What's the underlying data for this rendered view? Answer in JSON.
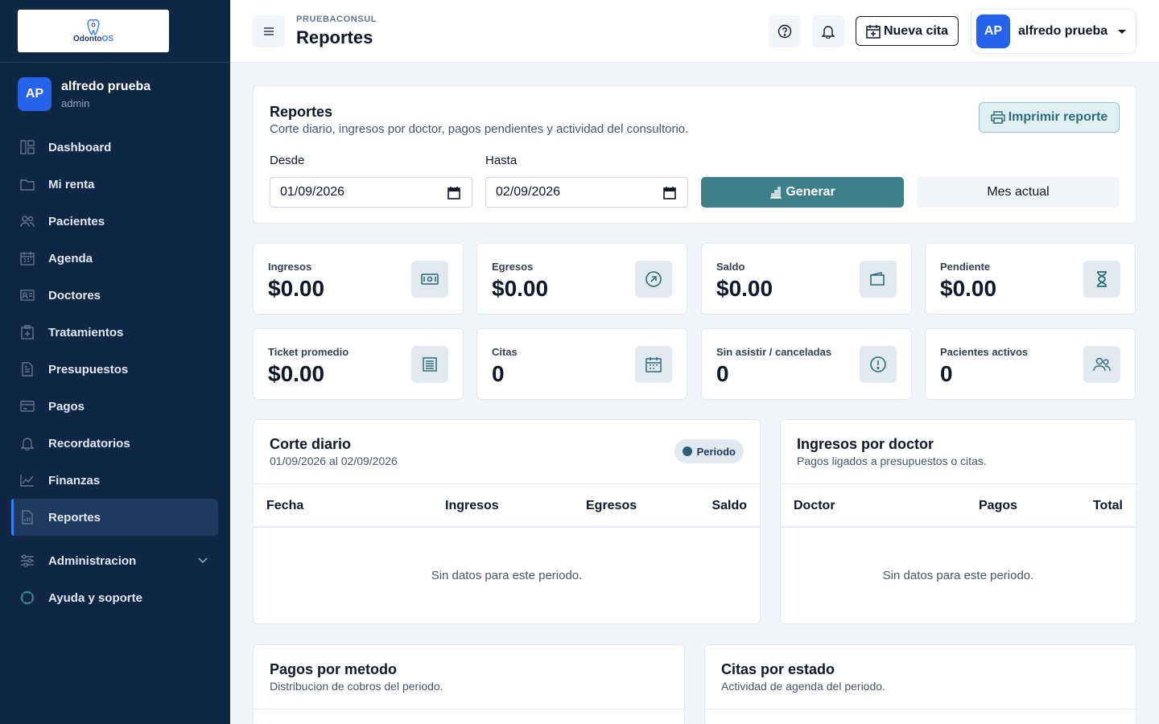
{
  "brand": {
    "logo_text_a": "Odonto",
    "logo_text_b": "OS"
  },
  "sidebar": {
    "user": {
      "initials": "AP",
      "name": "alfredo prueba",
      "role": "admin"
    },
    "items": [
      {
        "label": "Dashboard",
        "icon": "dashboard-icon"
      },
      {
        "label": "Mi renta",
        "icon": "folder-icon"
      },
      {
        "label": "Pacientes",
        "icon": "users-icon"
      },
      {
        "label": "Agenda",
        "icon": "calendar-icon"
      },
      {
        "label": "Doctores",
        "icon": "id-card-icon"
      },
      {
        "label": "Tratamientos",
        "icon": "clipboard-plus-icon"
      },
      {
        "label": "Presupuestos",
        "icon": "document-icon"
      },
      {
        "label": "Pagos",
        "icon": "credit-card-icon"
      },
      {
        "label": "Recordatorios",
        "icon": "bell-icon"
      },
      {
        "label": "Finanzas",
        "icon": "chart-line-icon"
      },
      {
        "label": "Reportes",
        "icon": "report-icon",
        "active": true
      }
    ],
    "admin": {
      "label": "Administracion"
    },
    "support": {
      "label": "Ayuda y soporte"
    }
  },
  "header": {
    "breadcrumb": "PRUEBACONSUL",
    "title": "Reportes",
    "new_appointment": "Nueva cita",
    "user": {
      "initials": "AP",
      "name": "alfredo prueba"
    }
  },
  "filters": {
    "title": "Reportes",
    "subtitle": "Corte diario, ingresos por doctor, pagos pendientes y actividad del consultorio.",
    "print_label": "Imprimir reporte",
    "from_label": "Desde",
    "from_value": "01/09/2026",
    "to_label": "Hasta",
    "to_value": "02/09/2026",
    "generate_label": "Generar",
    "current_month_label": "Mes actual"
  },
  "stats": [
    {
      "label": "Ingresos",
      "value": "$0.00",
      "icon": "cash-icon"
    },
    {
      "label": "Egresos",
      "value": "$0.00",
      "icon": "arrow-up-right-icon"
    },
    {
      "label": "Saldo",
      "value": "$0.00",
      "icon": "wallet-icon"
    },
    {
      "label": "Pendiente",
      "value": "$0.00",
      "icon": "hourglass-icon"
    },
    {
      "label": "Ticket promedio",
      "value": "$0.00",
      "icon": "receipt-icon"
    },
    {
      "label": "Citas",
      "value": "0",
      "icon": "calendar-icon"
    },
    {
      "label": "Sin asistir / canceladas",
      "value": "0",
      "icon": "alert-circle-icon"
    },
    {
      "label": "Pacientes activos",
      "value": "0",
      "icon": "users-icon"
    }
  ],
  "corte": {
    "title": "Corte diario",
    "subtitle": "01/09/2026 al 02/09/2026",
    "badge": "Periodo",
    "columns": [
      "Fecha",
      "Ingresos",
      "Egresos",
      "Saldo"
    ],
    "empty": "Sin datos para este periodo."
  },
  "doctor": {
    "title": "Ingresos por doctor",
    "subtitle": "Pagos ligados a presupuestos o citas.",
    "columns": [
      "Doctor",
      "Pagos",
      "Total"
    ],
    "empty": "Sin datos para este periodo."
  },
  "metodo": {
    "title": "Pagos por metodo",
    "subtitle": "Distribucion de cobros del periodo."
  },
  "estado": {
    "title": "Citas por estado",
    "subtitle": "Actividad de agenda del periodo."
  }
}
